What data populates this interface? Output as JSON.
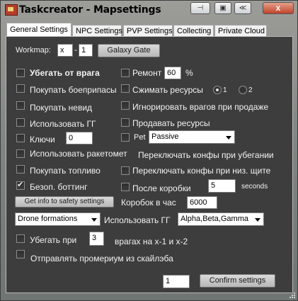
{
  "window": {
    "title": "Taskcreator - Mapsettings",
    "close_glyph": "x"
  },
  "tabs": [
    "General Settings",
    "NPC Settings",
    "PVP Settings",
    "Collecting",
    "Private Cloud"
  ],
  "workmap": {
    "label": "Workmap:",
    "x": "x",
    "y": "1",
    "gg_button": "Galaxy Gate"
  },
  "left_options": [
    {
      "label": "Убегать от врага",
      "checked": false
    },
    {
      "label": "Покупать боеприпасы",
      "checked": false
    },
    {
      "label": "Покупать невид",
      "checked": false
    },
    {
      "label": "Использовать ГГ",
      "checked": false
    },
    {
      "label": "Ключи",
      "checked": false
    },
    {
      "label": "Использовать ракетомет",
      "checked": false
    },
    {
      "label": "Покупать топливо",
      "checked": false
    },
    {
      "label": "Безоп. боттинг",
      "checked": true
    }
  ],
  "keys_value": "0",
  "right_options": {
    "repair": {
      "label": "Ремонт",
      "value": "60",
      "unit": "%"
    },
    "compress": {
      "label": "Сжимать ресурсы",
      "radio1": "1",
      "radio2": "2"
    },
    "ignore": {
      "label": "Игнорировать врагов при продаже"
    },
    "sell": {
      "label": "Продавать ресурсы"
    },
    "pet": {
      "label": "Pet",
      "value": "Passive"
    },
    "switch_flee": {
      "label": "Переключать конфы при убегании"
    },
    "switch_low": {
      "label": "Переключать конфы при низ. щите"
    },
    "after_box": {
      "label": "После коробки",
      "value": "5",
      "unit": "seconds"
    }
  },
  "safety_button": "Get info to safety settings",
  "boxes": {
    "label": "Коробок в час",
    "value": "6000"
  },
  "drone": {
    "value": "Drone formations"
  },
  "use_gg": {
    "label": "Использовать ГГ",
    "value": "Alpha,Beta,Gamma"
  },
  "flee_at": {
    "label": "Убегать при",
    "value": "3",
    "suffix": "врагах на x-1 и x-2"
  },
  "promerium": {
    "label": "Отправлять промериум из скайлэба"
  },
  "footer": {
    "value": "1",
    "confirm": "Confirm settings"
  }
}
